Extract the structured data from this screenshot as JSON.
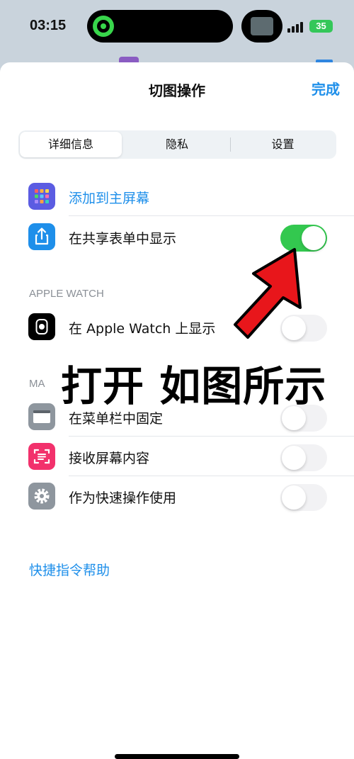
{
  "status_bar": {
    "time": "03:15",
    "battery": "35"
  },
  "sheet": {
    "title": "切图操作",
    "done_label": "完成",
    "tabs": [
      {
        "label": "详细信息",
        "selected": true
      },
      {
        "label": "隐私",
        "selected": false
      },
      {
        "label": "设置",
        "selected": false
      }
    ]
  },
  "rows": {
    "add_home": {
      "label": "添加到主屏幕"
    },
    "share_sheet": {
      "label": "在共享表单中显示",
      "on": true
    }
  },
  "apple_watch": {
    "header": "APPLE WATCH",
    "show": {
      "label": "在 Apple Watch 上显示",
      "on": false
    }
  },
  "mac": {
    "header": "MA",
    "menubar": {
      "label": "在菜单栏中固定",
      "on": false
    },
    "receive_screen": {
      "label": "接收屏幕内容",
      "on": false
    },
    "quick_action": {
      "label": "作为快速操作使用",
      "on": false
    }
  },
  "help_link": "快捷指令帮助",
  "annotation": "打开 如图所示",
  "colors": {
    "accent": "#1e8fea",
    "toggle_on": "#33c84f",
    "arrow": "#e8161b"
  }
}
